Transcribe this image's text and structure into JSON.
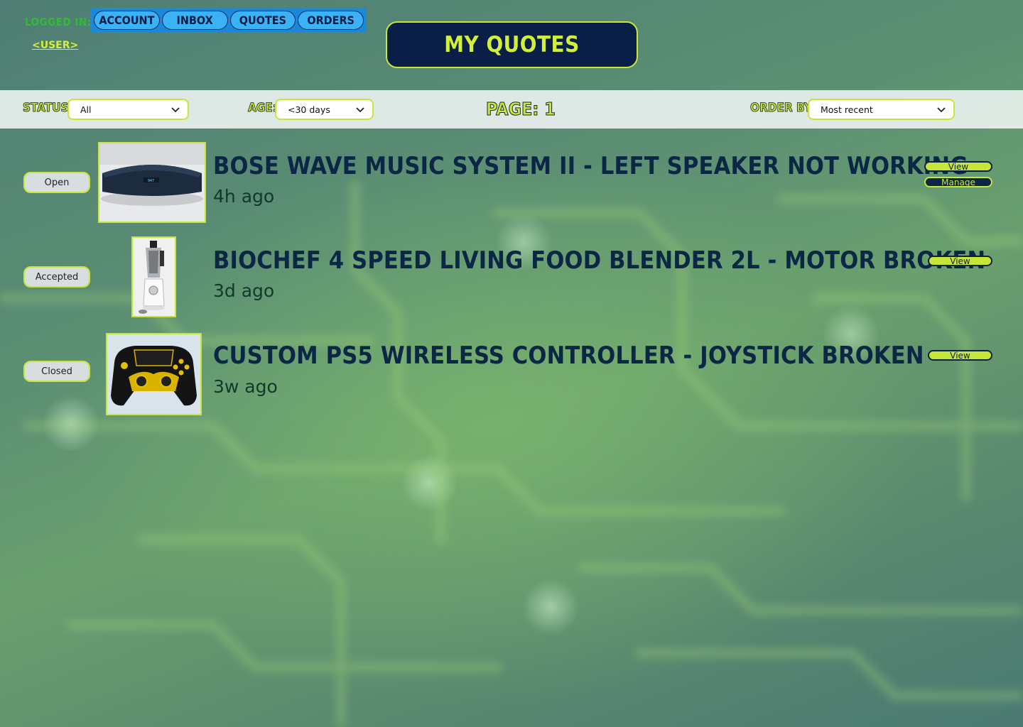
{
  "header": {
    "logged_in_label": "Logged in:",
    "user_label": "<user>",
    "nav": [
      {
        "label": "Account"
      },
      {
        "label": "Inbox"
      },
      {
        "label": "Quotes"
      },
      {
        "label": "Orders"
      }
    ],
    "page_title": "My Quotes"
  },
  "filters": {
    "status_label": "Status:",
    "status_value": "All",
    "age_label": "Age:",
    "age_value": "<30 days",
    "page_label": "Page: 1",
    "order_label": "Order by:",
    "order_value": "Most recent"
  },
  "quotes": [
    {
      "status": "Open",
      "title": "Bose Wave Music System II - left speaker not working",
      "age": "4h ago",
      "actions": [
        "View",
        "Manage"
      ]
    },
    {
      "status": "Accepted",
      "title": "BioChef 4 Speed Living Food Blender 2L - motor broken",
      "age": "3d ago",
      "actions": [
        "View"
      ]
    },
    {
      "status": "Closed",
      "title": "Custom PS5 Wireless Controller - joystick broken",
      "age": "3w ago",
      "actions": [
        "View"
      ]
    }
  ],
  "colors": {
    "accent": "#c7e63a",
    "navy": "#0a1f47",
    "nav_blue": "#3ab2f5",
    "logged_in_green": "#34b83a"
  }
}
